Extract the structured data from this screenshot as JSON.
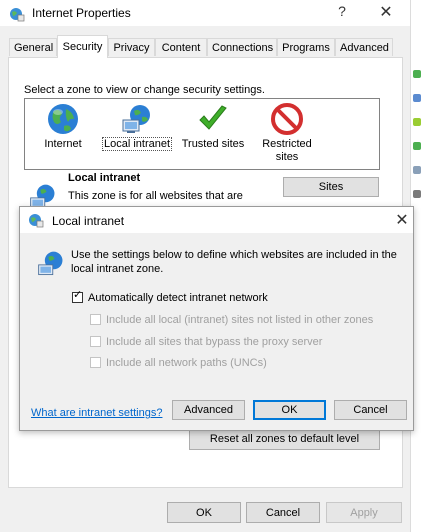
{
  "window": {
    "title": "Internet Properties",
    "help_glyph": "?",
    "close_glyph": "✕"
  },
  "tabs": [
    {
      "label": "General"
    },
    {
      "label": "Security"
    },
    {
      "label": "Privacy"
    },
    {
      "label": "Content"
    },
    {
      "label": "Connections"
    },
    {
      "label": "Programs"
    },
    {
      "label": "Advanced"
    }
  ],
  "security": {
    "instruction": "Select a zone to view or change security settings.",
    "zones": [
      {
        "label": "Internet",
        "icon": "globe-icon"
      },
      {
        "label": "Local intranet",
        "icon": "intranet-icon"
      },
      {
        "label": "Trusted sites",
        "icon": "checkmark-icon"
      },
      {
        "label": "Restricted sites",
        "icon": "restricted-icon"
      }
    ],
    "zone_title": "Local intranet",
    "zone_desc": "This zone is for all websites that are",
    "sites_label": "Sites",
    "reset_label": "Reset all zones to default level"
  },
  "footer": {
    "ok": "OK",
    "cancel": "Cancel",
    "apply": "Apply"
  },
  "dialog": {
    "title": "Local intranet",
    "close_glyph": "✕",
    "description": "Use the settings below to define which websites are included in the local intranet zone.",
    "checkboxes": [
      {
        "label": "Automatically detect intranet network",
        "checked": true,
        "enabled": true
      },
      {
        "label": "Include all local (intranet) sites not listed in other zones",
        "checked": false,
        "enabled": false
      },
      {
        "label": "Include all sites that bypass the proxy server",
        "checked": false,
        "enabled": false
      },
      {
        "label": "Include all network paths (UNCs)",
        "checked": false,
        "enabled": false
      }
    ],
    "link": "What are intranet settings?",
    "advanced": "Advanced",
    "ok": "OK",
    "cancel": "Cancel"
  },
  "colors": {
    "accent": "#0078d7",
    "link": "#0066cc",
    "restricted": "#d32f2f",
    "check_green": "#3fae2a"
  }
}
